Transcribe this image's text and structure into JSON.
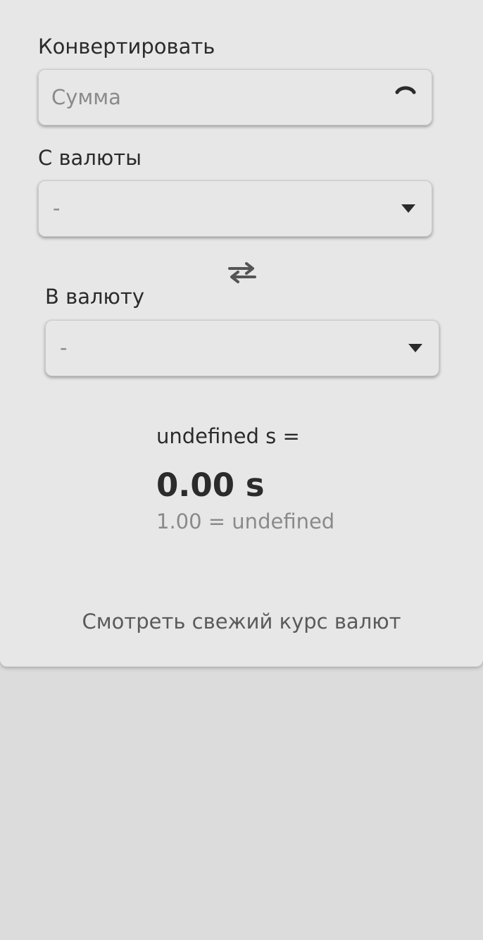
{
  "converter": {
    "amount_label": "Конвертировать",
    "amount_placeholder": "Сумма",
    "from_label": "С валюты",
    "from_value": "-",
    "to_label": "В валюту",
    "to_value": "-",
    "result_from": "undefined s =",
    "result_to": "0.00 s",
    "rate": "1.00 = undefined",
    "fresh_rates_link": "Смотреть свежий курс валют"
  },
  "icons": {
    "amount_spinner": "spinner-icon",
    "from_dropdown": "caret-down-icon",
    "to_dropdown": "caret-down-icon",
    "swap": "swap-arrows-icon"
  },
  "colors": {
    "page_background": "#dcdcdc",
    "card_background": "#e8e7e7",
    "text_primary": "#2b2b2b",
    "text_muted": "#8a8a8a"
  }
}
